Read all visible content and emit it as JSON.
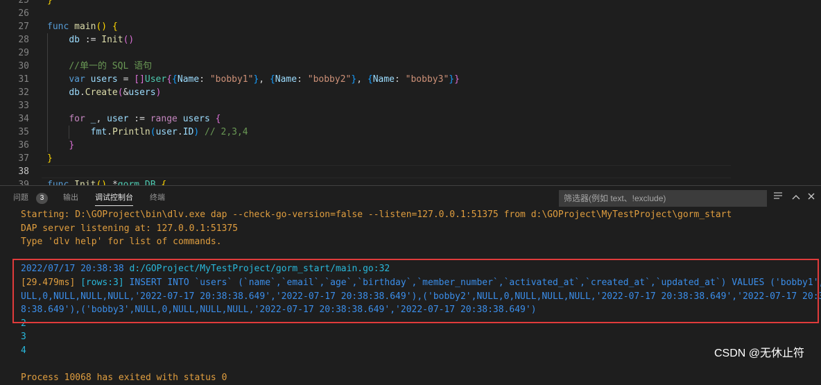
{
  "editor": {
    "lines": [
      {
        "n": "25",
        "tokens": [
          {
            "t": "}",
            "c": "p1"
          }
        ]
      },
      {
        "n": "26",
        "tokens": []
      },
      {
        "n": "27",
        "tokens": [
          {
            "t": "func ",
            "c": "kw"
          },
          {
            "t": "main",
            "c": "fn"
          },
          {
            "t": "()",
            "c": "p1"
          },
          {
            "t": " ",
            "c": "op"
          },
          {
            "t": "{",
            "c": "p1"
          }
        ]
      },
      {
        "n": "28",
        "tokens": [
          {
            "t": "    ",
            "c": "op"
          },
          {
            "t": "db",
            "c": "id"
          },
          {
            "t": " := ",
            "c": "op"
          },
          {
            "t": "Init",
            "c": "fn"
          },
          {
            "t": "()",
            "c": "p2"
          }
        ]
      },
      {
        "n": "29",
        "tokens": []
      },
      {
        "n": "30",
        "tokens": [
          {
            "t": "    ",
            "c": "op"
          },
          {
            "t": "//单一的 SQL 语句",
            "c": "cm"
          }
        ]
      },
      {
        "n": "31",
        "tokens": [
          {
            "t": "    ",
            "c": "op"
          },
          {
            "t": "var ",
            "c": "kw"
          },
          {
            "t": "users",
            "c": "id"
          },
          {
            "t": " = ",
            "c": "op"
          },
          {
            "t": "[]",
            "c": "p2"
          },
          {
            "t": "User",
            "c": "ty"
          },
          {
            "t": "{",
            "c": "p2"
          },
          {
            "t": "{",
            "c": "p3"
          },
          {
            "t": "Name",
            "c": "id"
          },
          {
            "t": ": ",
            "c": "op"
          },
          {
            "t": "\"bobby1\"",
            "c": "st"
          },
          {
            "t": "}",
            "c": "p3"
          },
          {
            "t": ", ",
            "c": "op"
          },
          {
            "t": "{",
            "c": "p3"
          },
          {
            "t": "Name",
            "c": "id"
          },
          {
            "t": ": ",
            "c": "op"
          },
          {
            "t": "\"bobby2\"",
            "c": "st"
          },
          {
            "t": "}",
            "c": "p3"
          },
          {
            "t": ", ",
            "c": "op"
          },
          {
            "t": "{",
            "c": "p3"
          },
          {
            "t": "Name",
            "c": "id"
          },
          {
            "t": ": ",
            "c": "op"
          },
          {
            "t": "\"bobby3\"",
            "c": "st"
          },
          {
            "t": "}",
            "c": "p3"
          },
          {
            "t": "}",
            "c": "p2"
          }
        ]
      },
      {
        "n": "32",
        "tokens": [
          {
            "t": "    ",
            "c": "op"
          },
          {
            "t": "db",
            "c": "id"
          },
          {
            "t": ".",
            "c": "op"
          },
          {
            "t": "Create",
            "c": "fn"
          },
          {
            "t": "(",
            "c": "p2"
          },
          {
            "t": "&",
            "c": "op"
          },
          {
            "t": "users",
            "c": "id"
          },
          {
            "t": ")",
            "c": "p2"
          }
        ]
      },
      {
        "n": "33",
        "tokens": []
      },
      {
        "n": "34",
        "tokens": [
          {
            "t": "    ",
            "c": "op"
          },
          {
            "t": "for ",
            "c": "ctl"
          },
          {
            "t": "_",
            "c": "id"
          },
          {
            "t": ", ",
            "c": "op"
          },
          {
            "t": "user",
            "c": "id"
          },
          {
            "t": " := ",
            "c": "op"
          },
          {
            "t": "range ",
            "c": "ctl"
          },
          {
            "t": "users",
            "c": "id"
          },
          {
            "t": " ",
            "c": "op"
          },
          {
            "t": "{",
            "c": "p2"
          }
        ]
      },
      {
        "n": "35",
        "tokens": [
          {
            "t": "        ",
            "c": "op"
          },
          {
            "t": "fmt",
            "c": "id"
          },
          {
            "t": ".",
            "c": "op"
          },
          {
            "t": "Println",
            "c": "fn"
          },
          {
            "t": "(",
            "c": "p3"
          },
          {
            "t": "user",
            "c": "id"
          },
          {
            "t": ".",
            "c": "op"
          },
          {
            "t": "ID",
            "c": "id"
          },
          {
            "t": ")",
            "c": "p3"
          },
          {
            "t": " ",
            "c": "op"
          },
          {
            "t": "// 2,3,4",
            "c": "cm"
          }
        ]
      },
      {
        "n": "36",
        "tokens": [
          {
            "t": "    ",
            "c": "op"
          },
          {
            "t": "}",
            "c": "p2"
          }
        ]
      },
      {
        "n": "37",
        "tokens": [
          {
            "t": "}",
            "c": "p1"
          }
        ]
      },
      {
        "n": "38",
        "tokens": [],
        "active": true
      },
      {
        "n": "39",
        "tokens": [
          {
            "t": "func ",
            "c": "kw"
          },
          {
            "t": "Init",
            "c": "fn"
          },
          {
            "t": "() ",
            "c": "p1"
          },
          {
            "t": "*",
            "c": "op"
          },
          {
            "t": "gorm",
            "c": "ty"
          },
          {
            "t": ".",
            "c": "op"
          },
          {
            "t": "DB ",
            "c": "ty"
          },
          {
            "t": "{",
            "c": "p1"
          }
        ]
      }
    ]
  },
  "panel": {
    "tabs": [
      {
        "label": "问题",
        "active": false
      },
      {
        "label": "输出",
        "active": false
      },
      {
        "label": "调试控制台",
        "active": true
      },
      {
        "label": "终端",
        "active": false
      }
    ],
    "problems_count": "3",
    "filter_placeholder": "筛选器(例如 text、!exclude)",
    "console": [
      {
        "text": "Starting: D:\\GOProject\\bin\\dlv.exe dap --check-go-version=false --listen=127.0.0.1:51375 from d:\\GOProject\\MyTestProject\\gorm_start",
        "parts": [
          {
            "t": "Starting: D:\\GOProject\\bin\\dlv.exe dap --check-go-version=false --listen=127.0.0.1:51375 from d:\\GOProject\\MyTestProject\\gorm_start",
            "c": "orange"
          }
        ]
      },
      {
        "parts": [
          {
            "t": "DAP server listening at: 127.0.0.1:51375",
            "c": "orange"
          }
        ]
      },
      {
        "parts": [
          {
            "t": "Type 'dlv help' for list of commands.",
            "c": "orange"
          }
        ]
      },
      {
        "parts": []
      },
      {
        "parts": [
          {
            "t": "2022/07/17 20:38:38 ",
            "c": "blue"
          },
          {
            "t": "d:/GOProject/MyTestProject/gorm_start/main.go:32",
            "c": "cyan"
          }
        ]
      },
      {
        "parts": [
          {
            "t": "[29.479ms] ",
            "c": "orange"
          },
          {
            "t": "[rows:3] ",
            "c": "cyan"
          },
          {
            "t": "INSERT INTO `users` (`name`,`email`,`age`,`birthday`,`member_number`,`activated_at`,`created_at`,`updated_at`) VALUES ('bobby1',N",
            "c": "blue"
          }
        ]
      },
      {
        "parts": [
          {
            "t": "ULL,0,NULL,NULL,NULL,'2022-07-17 20:38:38.649','2022-07-17 20:38:38.649'),('bobby2',NULL,0,NULL,NULL,NULL,'2022-07-17 20:38:38.649','2022-07-17 20:3",
            "c": "blue"
          }
        ]
      },
      {
        "parts": [
          {
            "t": "8:38.649'),('bobby3',NULL,0,NULL,NULL,NULL,'2022-07-17 20:38:38.649','2022-07-17 20:38:38.649')",
            "c": "blue"
          }
        ]
      },
      {
        "parts": [
          {
            "t": "2",
            "c": "cyan"
          }
        ]
      },
      {
        "parts": [
          {
            "t": "3",
            "c": "cyan"
          }
        ]
      },
      {
        "parts": [
          {
            "t": "4",
            "c": "cyan"
          }
        ]
      },
      {
        "parts": []
      },
      {
        "parts": [
          {
            "t": "Process 10068 has exited with status 0",
            "c": "orange"
          }
        ]
      }
    ]
  },
  "watermark": "CSDN @无休止符"
}
